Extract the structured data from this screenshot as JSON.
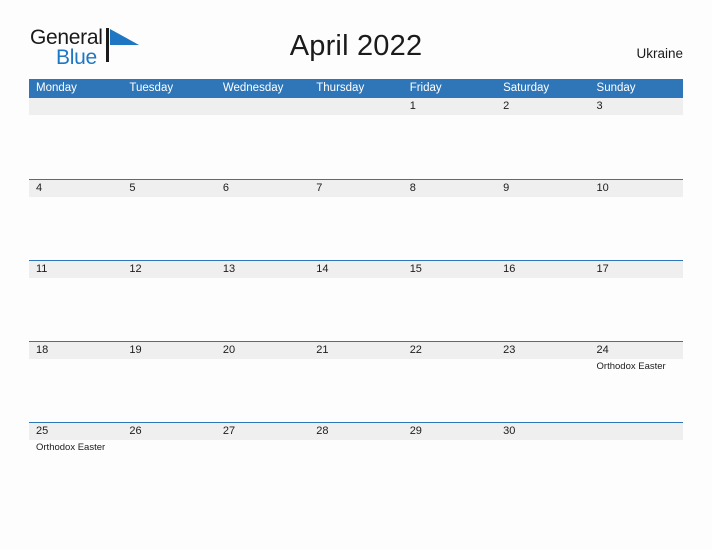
{
  "brand": {
    "name_top": "General",
    "name_bottom": "Blue",
    "accent_color": "#1f77c4",
    "flag_icon": "flag-triangle-icon"
  },
  "header": {
    "title": "April 2022",
    "region": "Ukraine"
  },
  "calendar": {
    "header_bg": "#2f76b8",
    "header_text_color": "#ffffff",
    "dateband_bg": "#efefef",
    "row_rule_color": "#2f76b8",
    "weekdays": [
      "Monday",
      "Tuesday",
      "Wednesday",
      "Thursday",
      "Friday",
      "Saturday",
      "Sunday"
    ],
    "weeks": [
      {
        "rule": false,
        "days": [
          {
            "num": "",
            "event": ""
          },
          {
            "num": "",
            "event": ""
          },
          {
            "num": "",
            "event": ""
          },
          {
            "num": "",
            "event": ""
          },
          {
            "num": "1",
            "event": ""
          },
          {
            "num": "2",
            "event": ""
          },
          {
            "num": "3",
            "event": ""
          }
        ]
      },
      {
        "rule": true,
        "days": [
          {
            "num": "4",
            "event": ""
          },
          {
            "num": "5",
            "event": ""
          },
          {
            "num": "6",
            "event": ""
          },
          {
            "num": "7",
            "event": ""
          },
          {
            "num": "8",
            "event": ""
          },
          {
            "num": "9",
            "event": ""
          },
          {
            "num": "10",
            "event": ""
          }
        ]
      },
      {
        "rule": true,
        "days": [
          {
            "num": "11",
            "event": ""
          },
          {
            "num": "12",
            "event": ""
          },
          {
            "num": "13",
            "event": ""
          },
          {
            "num": "14",
            "event": ""
          },
          {
            "num": "15",
            "event": ""
          },
          {
            "num": "16",
            "event": ""
          },
          {
            "num": "17",
            "event": ""
          }
        ]
      },
      {
        "rule": true,
        "days": [
          {
            "num": "18",
            "event": ""
          },
          {
            "num": "19",
            "event": ""
          },
          {
            "num": "20",
            "event": ""
          },
          {
            "num": "21",
            "event": ""
          },
          {
            "num": "22",
            "event": ""
          },
          {
            "num": "23",
            "event": ""
          },
          {
            "num": "24",
            "event": "Orthodox Easter"
          }
        ]
      },
      {
        "rule": true,
        "days": [
          {
            "num": "25",
            "event": "Orthodox Easter"
          },
          {
            "num": "26",
            "event": ""
          },
          {
            "num": "27",
            "event": ""
          },
          {
            "num": "28",
            "event": ""
          },
          {
            "num": "29",
            "event": ""
          },
          {
            "num": "30",
            "event": ""
          },
          {
            "num": "",
            "event": ""
          }
        ]
      }
    ]
  }
}
